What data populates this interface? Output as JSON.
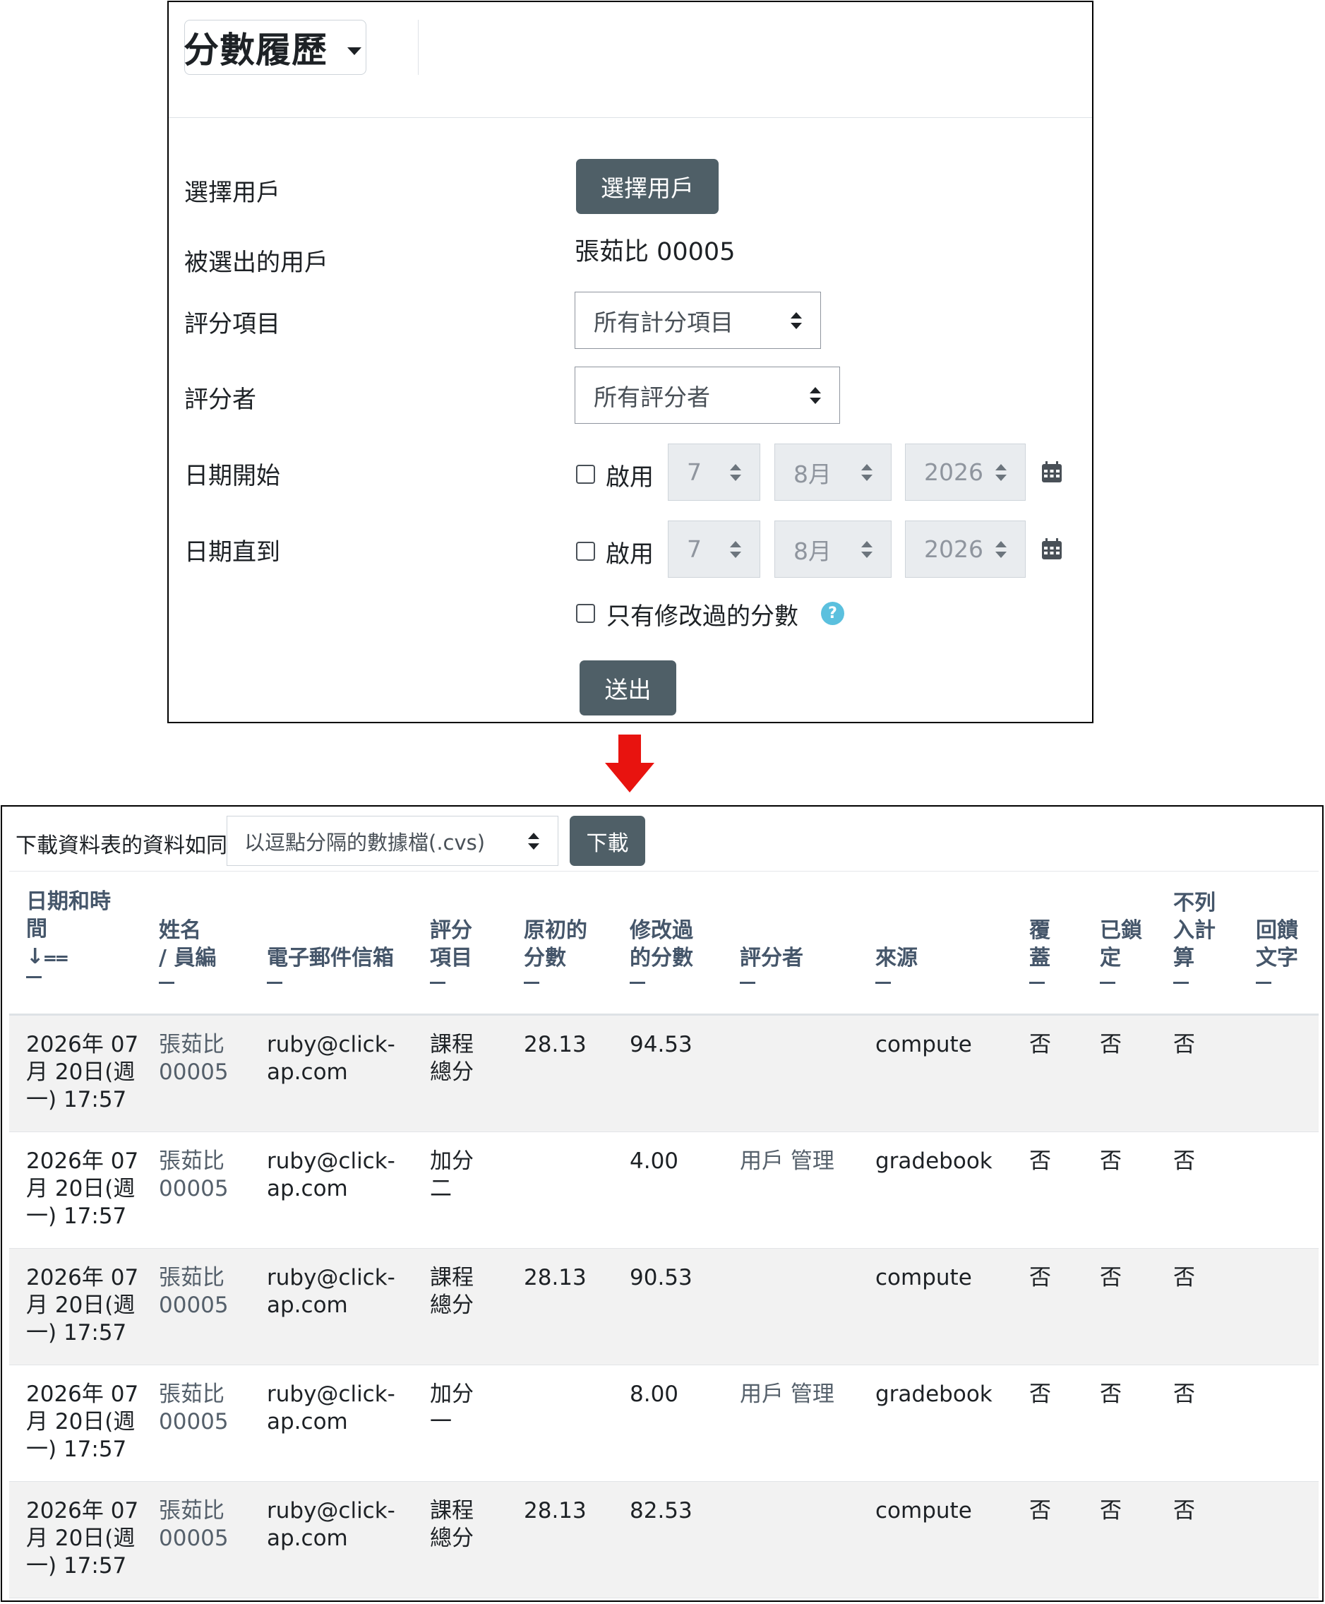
{
  "form": {
    "title": "分數履歷",
    "select_user_label": "選擇用戶",
    "select_user_button": "選擇用戶",
    "selected_user_label": "被選出的用戶",
    "selected_user_value": "張茹比 00005",
    "grade_item_label": "評分項目",
    "grade_item_value": "所有計分項目",
    "grader_label": "評分者",
    "grader_value": "所有評分者",
    "date_from_label": "日期開始",
    "date_to_label": "日期直到",
    "enable_label": "啟用",
    "date_day": "7",
    "date_month": "8月",
    "date_year": "2026",
    "only_modified_label": "只有修改過的分數",
    "help_icon_text": "?",
    "submit_button": "送出"
  },
  "download": {
    "label": "下載資料表的資料如同",
    "format_value": "以逗點分隔的數據檔(.cvs)",
    "button": "下載"
  },
  "table": {
    "headers": {
      "datetime_l1": "日期和時",
      "datetime_l2": "間",
      "sort_icon": "↓⩵",
      "name_l1": "姓名",
      "name_l2": "/ 員編",
      "email": "電子郵件信箱",
      "item_l1": "評分",
      "item_l2": "項目",
      "orig_l1": "原初的",
      "orig_l2": "分數",
      "rev_l1": "修改過",
      "rev_l2": "的分數",
      "grader": "評分者",
      "source": "來源",
      "override_l1": "覆",
      "override_l2": "蓋",
      "locked_l1": "已鎖",
      "locked_l2": "定",
      "excluded_l1": "不列",
      "excluded_l2": "入計",
      "excluded_l3": "算",
      "feedback_l1": "回饋",
      "feedback_l2": "文字"
    },
    "rows": [
      {
        "date_l1": "2026年 07",
        "date_l2": "月 20日(週",
        "date_l3": "一) 17:57",
        "name_l1": "張茹比",
        "name_l2": "00005",
        "email_l1": "ruby@click-",
        "email_l2": "ap.com",
        "item_l1": "課程",
        "item_l2": "總分",
        "original": "28.13",
        "revised": "94.53",
        "grader": "",
        "source": "compute",
        "override": "否",
        "locked": "否",
        "excluded": "否",
        "feedback": ""
      },
      {
        "date_l1": "2026年 07",
        "date_l2": "月 20日(週",
        "date_l3": "一) 17:57",
        "name_l1": "張茹比",
        "name_l2": "00005",
        "email_l1": "ruby@click-",
        "email_l2": "ap.com",
        "item_l1": "加分",
        "item_l2": "二",
        "original": "",
        "revised": "4.00",
        "grader": "用戶 管理",
        "source": "gradebook",
        "override": "否",
        "locked": "否",
        "excluded": "否",
        "feedback": ""
      },
      {
        "date_l1": "2026年 07",
        "date_l2": "月 20日(週",
        "date_l3": "一) 17:57",
        "name_l1": "張茹比",
        "name_l2": "00005",
        "email_l1": "ruby@click-",
        "email_l2": "ap.com",
        "item_l1": "課程",
        "item_l2": "總分",
        "original": "28.13",
        "revised": "90.53",
        "grader": "",
        "source": "compute",
        "override": "否",
        "locked": "否",
        "excluded": "否",
        "feedback": ""
      },
      {
        "date_l1": "2026年 07",
        "date_l2": "月 20日(週",
        "date_l3": "一) 17:57",
        "name_l1": "張茹比",
        "name_l2": "00005",
        "email_l1": "ruby@click-",
        "email_l2": "ap.com",
        "item_l1": "加分",
        "item_l2": "一",
        "original": "",
        "revised": "8.00",
        "grader": "用戶 管理",
        "source": "gradebook",
        "override": "否",
        "locked": "否",
        "excluded": "否",
        "feedback": ""
      },
      {
        "date_l1": "2026年 07",
        "date_l2": "月 20日(週",
        "date_l3": "一) 17:57",
        "name_l1": "張茹比",
        "name_l2": "00005",
        "email_l1": "ruby@click-",
        "email_l2": "ap.com",
        "item_l1": "課程",
        "item_l2": "總分",
        "original": "28.13",
        "revised": "82.53",
        "grader": "",
        "source": "compute",
        "override": "否",
        "locked": "否",
        "excluded": "否",
        "feedback": ""
      }
    ]
  },
  "colors": {
    "button_bg": "#4f5f67",
    "header_text": "#45566a",
    "arrow": "#e8130f",
    "help_icon": "#5bc0de"
  }
}
